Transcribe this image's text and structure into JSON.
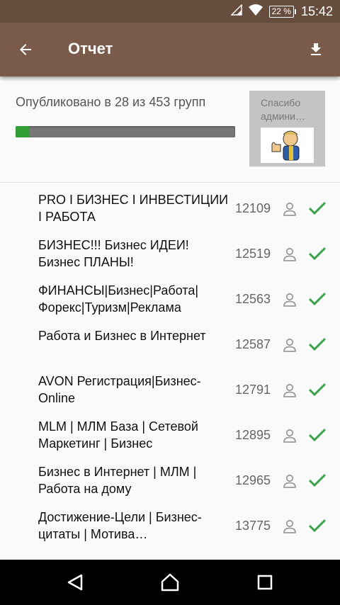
{
  "status_bar": {
    "battery": "22 %",
    "time": "15:42"
  },
  "app_bar": {
    "title": "Отчет"
  },
  "summary": {
    "published_text": "Опубликовано в 28 из 453 групп",
    "published_count": 28,
    "total_groups": 453,
    "progress_fraction": 0.062,
    "progress_color": "#2e9e35",
    "ad_text": "Спасибо админи…"
  },
  "groups": [
    {
      "name": "PRO I БИЗНЕС I ИНВЕСТИЦИИ I РАБОТА",
      "members": "12109"
    },
    {
      "name": "БИЗНЕС!!! Бизнес ИДЕИ! Бизнес ПЛАНЫ!",
      "members": "12519"
    },
    {
      "name": "ФИНАНСЫ|Бизнес|Работа|Форекс|Туризм|Реклама",
      "members": "12563"
    },
    {
      "name": "Работа и Бизнес в Интернет",
      "members": "12587"
    },
    {
      "name": "AVON Регистрация|Бизнес-Online",
      "members": "12791"
    },
    {
      "name": "MLM | МЛМ База | Сетевой Маркетинг | Бизнес",
      "members": "12895"
    },
    {
      "name": "Бизнес в Интернет | МЛМ | Работа на дому",
      "members": "12965"
    },
    {
      "name": "Достижение-Цели | Бизнес-цитаты | Мотива…",
      "members": "13775"
    }
  ],
  "colors": {
    "status_bar": "#664d3e",
    "app_bar": "#7a5a48",
    "check": "#3aa34a"
  }
}
